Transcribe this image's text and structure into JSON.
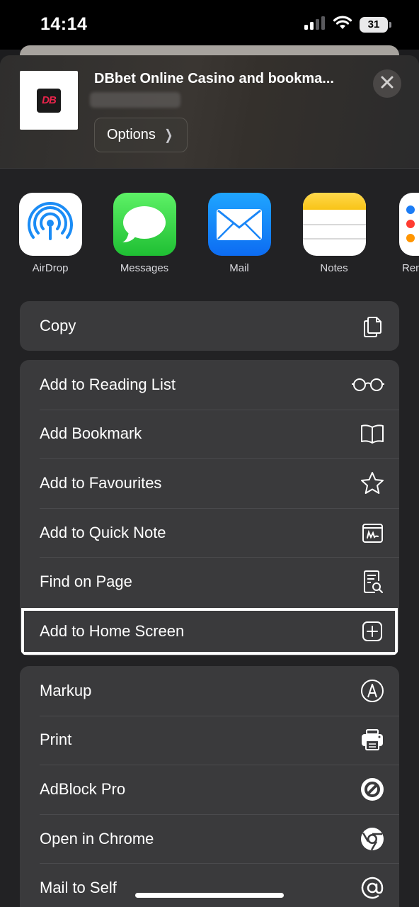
{
  "status_bar": {
    "time": "14:14",
    "battery": "31",
    "signal_icon": "cellular-signal-icon",
    "wifi_icon": "wifi-icon"
  },
  "share_sheet": {
    "site_title": "DBbet Online Casino and bookma...",
    "site_logo_text": "DB",
    "options_label": "Options",
    "close_icon": "close-icon"
  },
  "apps": [
    {
      "label": "AirDrop",
      "icon": "airdrop-icon"
    },
    {
      "label": "Messages",
      "icon": "messages-icon"
    },
    {
      "label": "Mail",
      "icon": "mail-icon"
    },
    {
      "label": "Notes",
      "icon": "notes-icon"
    },
    {
      "label": "Rem",
      "icon": "reminders-icon"
    }
  ],
  "actions": {
    "group1": [
      {
        "label": "Copy",
        "icon": "copy-icon"
      }
    ],
    "group2": [
      {
        "label": "Add to Reading List",
        "icon": "glasses-icon"
      },
      {
        "label": "Add Bookmark",
        "icon": "book-icon"
      },
      {
        "label": "Add to Favourites",
        "icon": "star-icon"
      },
      {
        "label": "Add to Quick Note",
        "icon": "quick-note-icon"
      },
      {
        "label": "Find on Page",
        "icon": "find-on-page-icon"
      },
      {
        "label": "Add to Home Screen",
        "icon": "plus-square-icon",
        "highlighted": true
      }
    ],
    "group3": [
      {
        "label": "Markup",
        "icon": "markup-icon"
      },
      {
        "label": "Print",
        "icon": "printer-icon"
      },
      {
        "label": "AdBlock Pro",
        "icon": "adblock-icon"
      },
      {
        "label": "Open in Chrome",
        "icon": "chrome-icon"
      },
      {
        "label": "Mail to Self",
        "icon": "at-sign-icon"
      }
    ]
  },
  "colors": {
    "sheet_background": "#222224",
    "group_background": "#3a3a3c",
    "highlight_outline": "#ffffff",
    "logo_red": "#e8244b"
  }
}
